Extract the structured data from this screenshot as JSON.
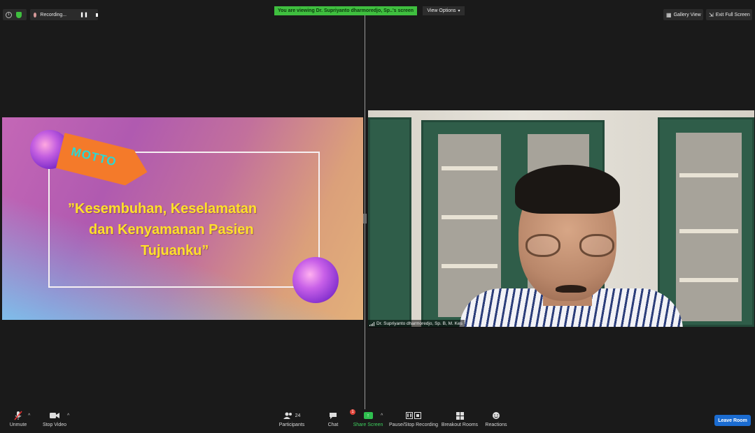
{
  "topbar": {
    "info_icon": "info-icon",
    "security_icon": "shield-icon",
    "recording_label": "Recording...",
    "viewing_banner": "You are viewing Dr. Supriyanto dharmoredjo, Sp..'s screen",
    "view_options_label": "View Options",
    "gallery_view_label": "Gallery View",
    "exit_full_screen_label": "Exit Full Screen"
  },
  "slide": {
    "tag": "MOTTO",
    "quote_line1": "”Kesembuhan,  Keselamatan",
    "quote_line2": "dan Kenyamanan Pasien",
    "quote_line3": "Tujuanku”"
  },
  "video": {
    "participant_name": "Dr. Supriyanto dharmoredjo, Sp. B, M. Kes"
  },
  "toolbar": {
    "unmute_label": "Unmute",
    "stop_video_label": "Stop Video",
    "participants_label": "Participants",
    "participants_count": "24",
    "chat_label": "Chat",
    "chat_badge": "1",
    "share_screen_label": "Share Screen",
    "recording_label": "Pause/Stop Recording",
    "breakout_label": "Breakout Rooms",
    "reactions_label": "Reactions",
    "leave_label": "Leave Room"
  },
  "colors": {
    "banner_green": "#3fbf3f",
    "leave_blue": "#1b6cd1",
    "share_green": "#2fbf4f",
    "quote_yellow": "#ffe02a",
    "motto_orange": "#f47a2a"
  }
}
